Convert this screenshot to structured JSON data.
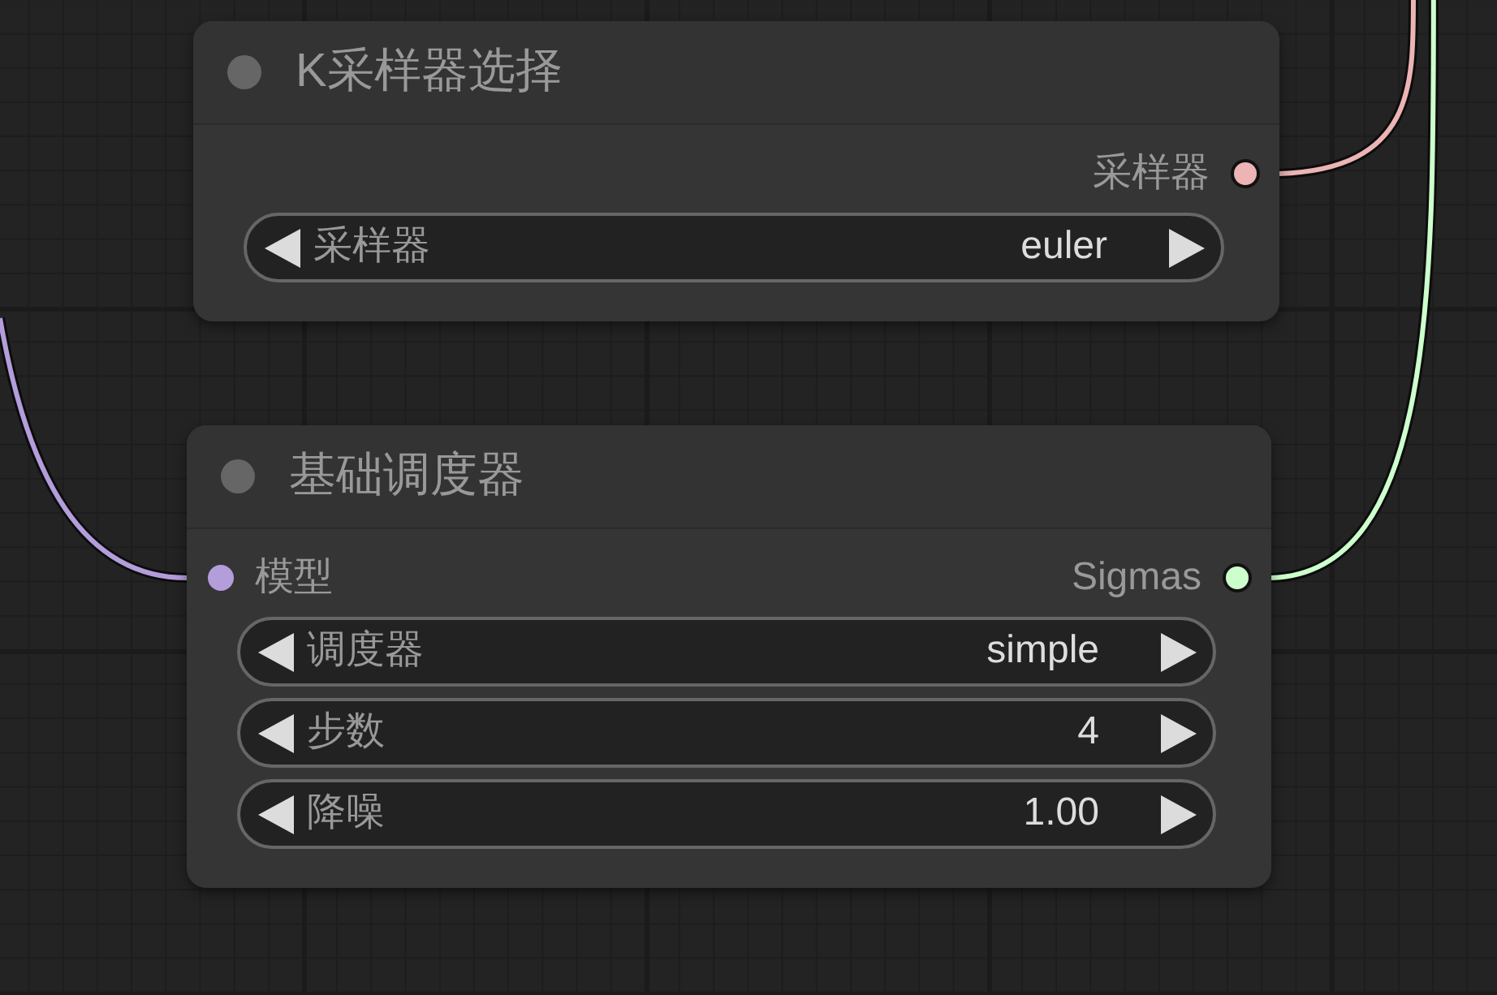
{
  "nodes": [
    {
      "title": "K采样器选择",
      "outputs": [
        {
          "label": "采样器",
          "color": "#ecb4b4",
          "linked": true
        }
      ],
      "widgets": [
        {
          "label": "采样器",
          "value": "euler"
        }
      ]
    },
    {
      "title": "基础调度器",
      "inputs": [
        {
          "label": "模型",
          "color": "#b39ddb",
          "linked": true
        }
      ],
      "outputs": [
        {
          "label": "Sigmas",
          "color": "#cdffcd",
          "linked": true
        }
      ],
      "widgets": [
        {
          "label": "调度器",
          "value": "simple"
        },
        {
          "label": "步数",
          "value": "4"
        },
        {
          "label": "降噪",
          "value": "1.00"
        }
      ]
    }
  ]
}
